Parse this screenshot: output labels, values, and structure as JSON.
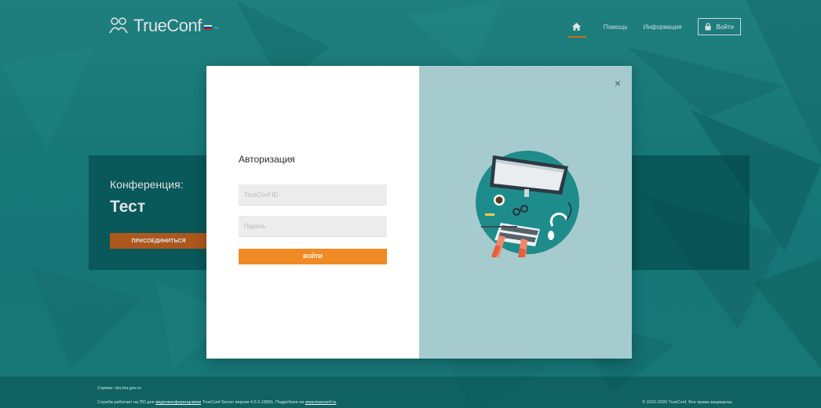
{
  "header": {
    "logo_text": "TrueConf",
    "language_flag": [
      "#ffffff",
      "#1c3fa0",
      "#d52b1e"
    ],
    "nav": {
      "home_icon": "home-icon",
      "help": "Помощь",
      "info": "Информация",
      "login": "Войти",
      "login_icon": "lock-icon"
    }
  },
  "conference": {
    "label": "Конференция:",
    "name": "Тест",
    "join_button": "ПРИСОЕДИНИТЬСЯ"
  },
  "modal": {
    "title": "Авторизация",
    "id_placeholder": "TrueConf ID",
    "password_placeholder": "Пароль",
    "submit": "ВОЙТИ",
    "close": "×"
  },
  "footer": {
    "server": "Сервер: vks.fsa.gov.ru",
    "about_prefix": "Служба работает на ПО для ",
    "about_link": "видеоконференцсвязи",
    "about_mid": " TrueConf Server версия 4.5.0.15891. Подробнее на ",
    "about_site": "www.trueconf.ru",
    "about_suffix": ".",
    "copyright": "© 2010-2020 TrueConf. Все права защищены."
  },
  "colors": {
    "background": "#1f8a88",
    "accent": "#f08a24",
    "join": "#c4621e",
    "modal_right": "#a6cbce"
  }
}
